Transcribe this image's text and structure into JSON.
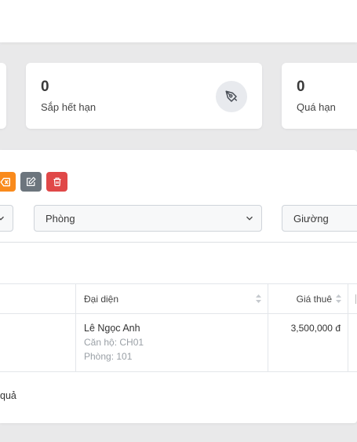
{
  "stats": [
    {
      "value": "0",
      "label": "Sắp hết hạn",
      "icon": "pen-nib-icon"
    },
    {
      "value": "0",
      "label": "Quá hạn"
    }
  ],
  "filters": {
    "room_select": "Phòng",
    "bed_select": "Giường"
  },
  "table": {
    "columns": [
      "Đại diện",
      "Giá thuê"
    ],
    "rows": [
      {
        "representative": "Lê Ngọc Anh",
        "apartment": "Căn hộ: CH01",
        "room": "Phòng: 101",
        "rent": "3,500,000 đ"
      }
    ]
  },
  "footer_text": "quả",
  "colors": {
    "orange": "#f98a1c",
    "gray": "#6c757d",
    "red": "#e04848"
  }
}
